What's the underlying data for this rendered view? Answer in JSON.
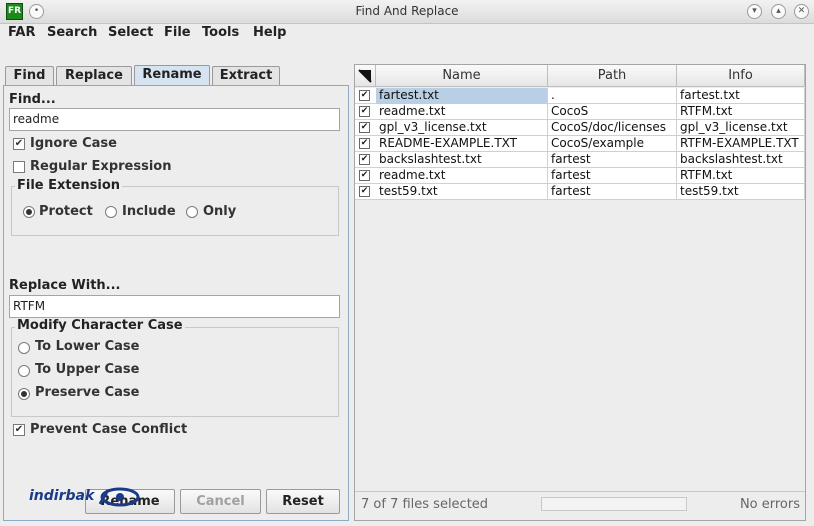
{
  "window": {
    "title": "Find And Replace",
    "app_icon_text": "FR"
  },
  "menubar": [
    "FAR",
    "Search",
    "Select",
    "File",
    "Tools",
    "Help"
  ],
  "tabs": [
    {
      "label": "Find",
      "active": false
    },
    {
      "label": "Replace",
      "active": false
    },
    {
      "label": "Rename",
      "active": true
    },
    {
      "label": "Extract",
      "active": false
    }
  ],
  "find": {
    "label": "Find...",
    "value": "readme",
    "ignore_case_label": "Ignore Case",
    "ignore_case": true,
    "regex_label": "Regular Expression",
    "regex": false
  },
  "file_extension": {
    "title": "File Extension",
    "options": [
      "Protect",
      "Include",
      "Only"
    ],
    "selected": "Protect"
  },
  "replace": {
    "label": "Replace With...",
    "value": "RTFM"
  },
  "modify_case": {
    "title": "Modify Character Case",
    "options": [
      "To Lower Case",
      "To Upper Case",
      "Preserve Case"
    ],
    "selected": "Preserve Case"
  },
  "prevent_conflict": {
    "label": "Prevent Case Conflict",
    "checked": true
  },
  "buttons": {
    "rename": "Rename",
    "cancel": "Cancel",
    "reset": "Reset"
  },
  "table": {
    "columns": [
      "Name",
      "Path",
      "Info"
    ],
    "rows": [
      {
        "checked": true,
        "name": "fartest.txt",
        "path": ".",
        "info": "fartest.txt",
        "selected": true
      },
      {
        "checked": true,
        "name": "readme.txt",
        "path": "CocoS",
        "info": "RTFM.txt",
        "selected": false
      },
      {
        "checked": true,
        "name": "gpl_v3_license.txt",
        "path": "CocoS/doc/licenses",
        "info": "gpl_v3_license.txt",
        "selected": false
      },
      {
        "checked": true,
        "name": "README-EXAMPLE.TXT",
        "path": "CocoS/example",
        "info": "RTFM-EXAMPLE.TXT",
        "selected": false
      },
      {
        "checked": true,
        "name": "backslashtest.txt",
        "path": "fartest",
        "info": "backslashtest.txt",
        "selected": false
      },
      {
        "checked": true,
        "name": "readme.txt",
        "path": "fartest",
        "info": "RTFM.txt",
        "selected": false
      },
      {
        "checked": true,
        "name": "test59.txt",
        "path": "fartest",
        "info": "test59.txt",
        "selected": false
      }
    ]
  },
  "status": {
    "count": "7 of 7 files selected",
    "errors": "No errors"
  },
  "watermark": "indirbak",
  "check_glyph": "✔",
  "colors": {
    "accent": "#d6e4f2",
    "selection": "#b8cfe5"
  }
}
